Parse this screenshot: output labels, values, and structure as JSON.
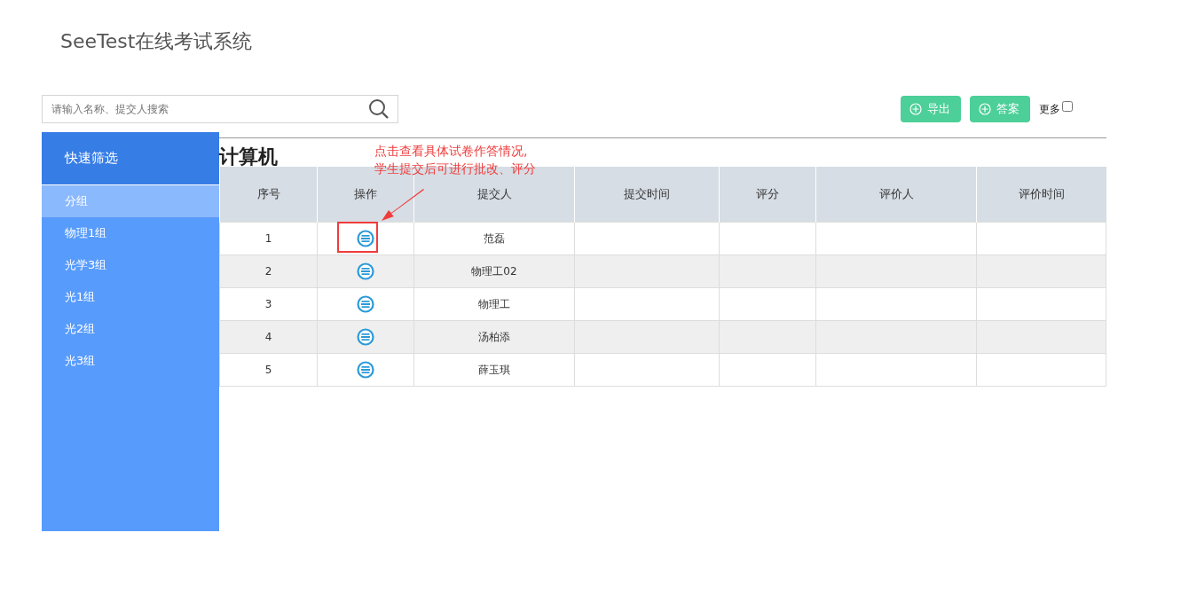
{
  "app_title": "SeeTest在线考试系统",
  "search": {
    "placeholder": "请输入名称、提交人搜索"
  },
  "buttons": [
    {
      "label": "导出"
    },
    {
      "label": "答案"
    }
  ],
  "more_option": {
    "label": "更多",
    "checked": false
  },
  "sidebar": {
    "header": "快速筛选",
    "items": [
      {
        "label": "分组",
        "selected": true
      },
      {
        "label": "物理1组",
        "selected": false
      },
      {
        "label": "光学3组",
        "selected": false
      },
      {
        "label": "光1组",
        "selected": false
      },
      {
        "label": "光2组",
        "selected": false
      },
      {
        "label": "光3组",
        "selected": false
      }
    ]
  },
  "section_title": "计算机",
  "annotation": {
    "lines": [
      "点击查看具体试卷作答情况,",
      "学生提交后可进行批改、评分"
    ]
  },
  "table": {
    "columns": [
      "序号",
      "操作",
      "提交人",
      "提交时间",
      "评分",
      "评价人",
      "评价时间"
    ],
    "rows": [
      {
        "index": "1",
        "submitter": "范磊",
        "highlighted": true
      },
      {
        "index": "2",
        "submitter": "物理工02",
        "highlighted": false
      },
      {
        "index": "3",
        "submitter": "物理工",
        "highlighted": false
      },
      {
        "index": "4",
        "submitter": "汤柏添",
        "highlighted": false
      },
      {
        "index": "5",
        "submitter": "薛玉琪",
        "highlighted": false
      }
    ]
  }
}
